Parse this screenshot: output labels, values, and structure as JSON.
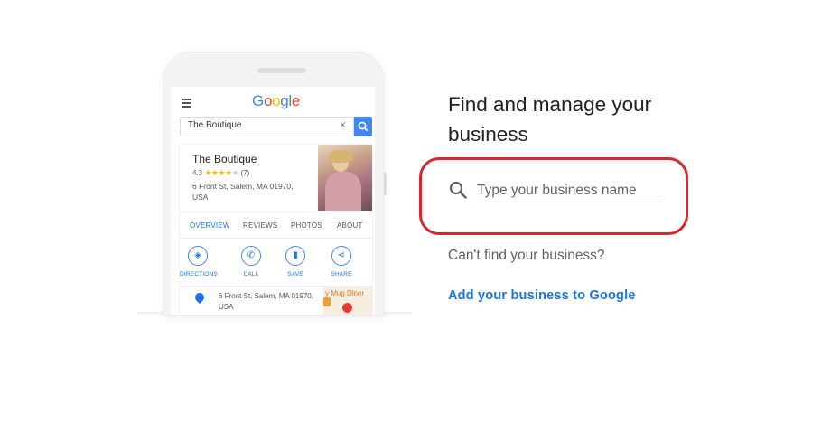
{
  "phone": {
    "search_query": "The Boutique",
    "clear_glyph": "×",
    "logo_letters": [
      {
        "char": "G",
        "color": "#4285f4"
      },
      {
        "char": "o",
        "color": "#ea4335"
      },
      {
        "char": "o",
        "color": "#fbbc05"
      },
      {
        "char": "g",
        "color": "#4285f4"
      },
      {
        "char": "l",
        "color": "#34a853"
      },
      {
        "char": "e",
        "color": "#ea4335"
      }
    ],
    "business": {
      "name": "The Boutique",
      "rating": "4.3",
      "stars_filled": "★★★★",
      "stars_empty": "★",
      "review_count": "(7)",
      "address": "6 Front St, Salem, MA 01970, USA"
    },
    "tabs": [
      "OVERVIEW",
      "REVIEWS",
      "PHOTOS",
      "ABOUT"
    ],
    "actions": [
      {
        "label": "DIRECTIONS",
        "icon": "directions-icon",
        "glyph": "◈"
      },
      {
        "label": "CALL",
        "icon": "phone-icon",
        "glyph": "✆"
      },
      {
        "label": "SAVE",
        "icon": "bookmark-icon",
        "glyph": "▮"
      },
      {
        "label": "SHARE",
        "icon": "share-icon",
        "glyph": "⋖"
      }
    ],
    "info_address": "6 Front St, Salem, MA 01970, USA",
    "map_label": "y Mug Diner"
  },
  "panel": {
    "heading": "Find and manage your business",
    "search_placeholder": "Type your business name",
    "cant_find": "Can't find your business?",
    "add_link": "Add your business to Google"
  },
  "colors": {
    "accent": "#1a73e8",
    "highlight_border": "#d8282b"
  }
}
